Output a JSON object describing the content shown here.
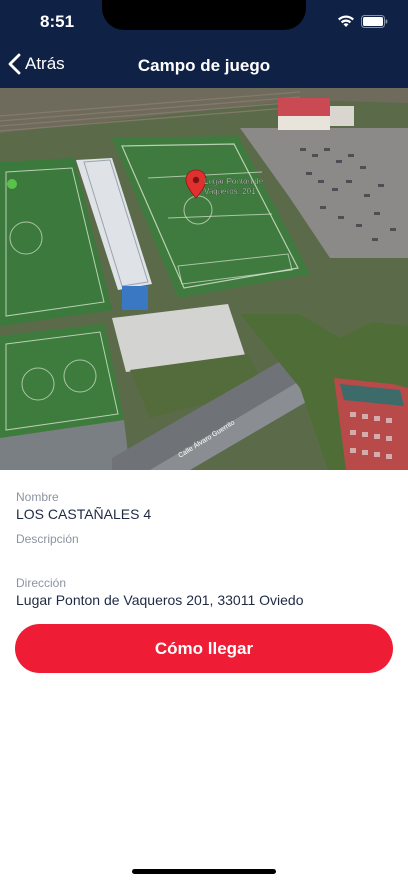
{
  "status_bar": {
    "time": "8:51",
    "icons": [
      "wifi-icon",
      "battery-icon"
    ]
  },
  "nav": {
    "back_label": "Atrás",
    "title": "Campo de juego"
  },
  "map": {
    "pin_label_line1": "Lugar Ponton de",
    "pin_label_line2": "Vaqueros, 201",
    "street_label": "Calle Álvaro Guerrito"
  },
  "details": {
    "name_label": "Nombre",
    "name_value": "LOS CASTAÑALES 4",
    "description_label": "Descripción",
    "description_value": "",
    "address_label": "Dirección",
    "address_value": "Lugar Ponton de Vaqueros 201, 33011 Oviedo"
  },
  "cta": {
    "label": "Cómo llegar"
  },
  "colors": {
    "header": "#0f2246",
    "accent": "#ee1c34",
    "label": "#8d93a0",
    "value": "#1e2a44"
  }
}
